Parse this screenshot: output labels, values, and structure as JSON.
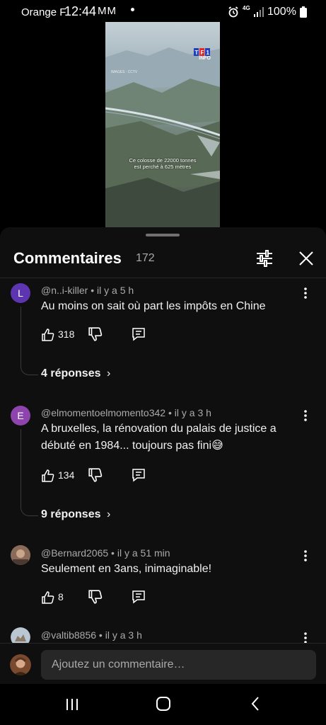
{
  "status_bar": {
    "carrier": "Orange F",
    "time": "12:44",
    "mail_icons": "MM",
    "network": "4G",
    "battery": "100%"
  },
  "video": {
    "logo_text": "TF1",
    "logo_sub": "INFO",
    "credit": "IMAGES : CCTV",
    "caption_line1": "Ce colosse de 22000 tonnes",
    "caption_line2": "est perché à 625 mètres"
  },
  "comments_panel": {
    "title": "Commentaires",
    "count": "172",
    "filter_icon": "tune-icon",
    "close_icon": "close-icon"
  },
  "comments": [
    {
      "avatar_letter": "L",
      "avatar_color": "#5e35b1",
      "author": "@n..i-killer",
      "time": "il y a 5 h",
      "text": "Au moins on sait où part les impôts en Chine",
      "likes": "318",
      "replies_label": "4 réponses"
    },
    {
      "avatar_letter": "E",
      "avatar_color": "#8e44ad",
      "author": "@elmomentoelmomento342",
      "time": "il y a 3 h",
      "text": "A bruxelles, la rénovation du palais de justice a débuté en 1984... toujours pas fini😅",
      "likes": "134",
      "replies_label": "9 réponses"
    },
    {
      "avatar_letter": "",
      "avatar_color": "#8a6b5a",
      "author": "@Bernard2065",
      "time": "il y a 51 min",
      "text": "Seulement en 3ans, inimaginable!",
      "likes": "8",
      "replies_label": ""
    },
    {
      "avatar_letter": "",
      "avatar_color": "#b9c7d3",
      "author": "@valtib8856",
      "time": "il y a 3 h",
      "text": "",
      "likes": "",
      "replies_label": ""
    }
  ],
  "input": {
    "placeholder": "Ajoutez un commentaire…"
  },
  "icons": {
    "like": "thumb-up-icon",
    "dislike": "thumb-down-icon",
    "reply": "reply-icon",
    "more": "more-vert-icon",
    "chevron": "chevron-right-icon"
  }
}
